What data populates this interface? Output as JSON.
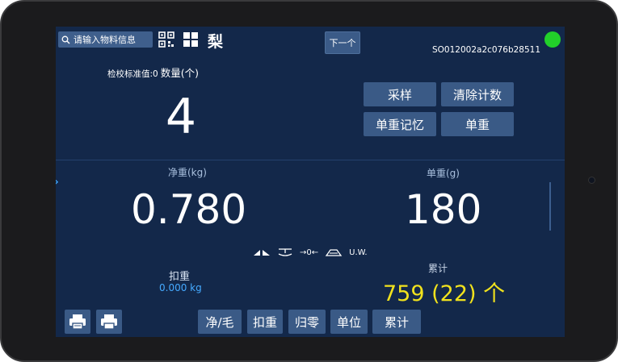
{
  "toolbar": {
    "search_label": "请输入物料信息",
    "product_name": "梨",
    "next_label": "下一个",
    "serial": "SO012002a2c076b28511"
  },
  "count_panel": {
    "calib_label": "检校标准值:0",
    "qty_label": "数量(个)",
    "count_value": "4"
  },
  "actions": {
    "sample": "采样",
    "clear_count": "清除计数",
    "unit_weight_memory": "单重记忆",
    "unit_weight": "单重"
  },
  "net": {
    "label": "净重(kg)",
    "value": "0.780"
  },
  "unit_weight": {
    "label": "单重(g)",
    "value": "180"
  },
  "indicators": {
    "zero_symbol": "→0←",
    "uw": "U.W."
  },
  "tare": {
    "label": "扣重",
    "value": "0.000 kg"
  },
  "accumulate": {
    "label": "累计",
    "value": "759 (22) 个"
  },
  "bottom_bar": {
    "net_gross": "净/毛",
    "tare": "扣重",
    "zero": "归零",
    "unit": "单位",
    "accumulate": "累计"
  },
  "colors": {
    "screen_bg": "#13284a",
    "button_bg": "#3a5a86",
    "status_green": "#22d02a",
    "accum_yellow": "#f1e21d",
    "tare_blue": "#45aaff"
  }
}
